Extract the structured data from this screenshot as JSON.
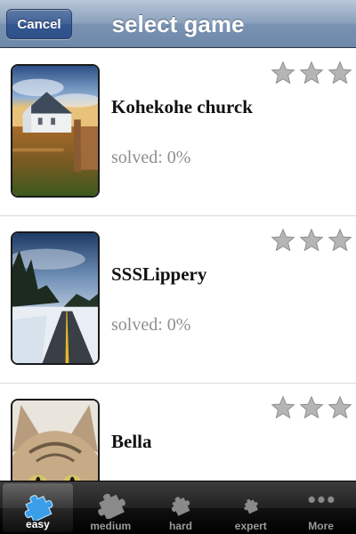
{
  "navbar": {
    "cancel_label": "Cancel",
    "title": "select game"
  },
  "games": [
    {
      "title": "Kohekohe churck",
      "status": "solved: 0%",
      "image": "church-photo",
      "stars": 3
    },
    {
      "title": "SSSLippery",
      "status": "solved: 0%",
      "image": "snowy-road-photo",
      "stars": 3
    },
    {
      "title": "Bella",
      "status": "",
      "image": "cat-photo",
      "stars": 3
    }
  ],
  "tabs": [
    {
      "label": "easy",
      "icon": "puzzle-piece-icon",
      "active": true
    },
    {
      "label": "medium",
      "icon": "puzzle-piece-icon",
      "active": false
    },
    {
      "label": "hard",
      "icon": "puzzle-piece-icon",
      "active": false
    },
    {
      "label": "expert",
      "icon": "puzzle-piece-icon",
      "active": false
    },
    {
      "label": "More",
      "icon": "more-dots-icon",
      "active": false
    }
  ],
  "colors": {
    "navbar": "#7a93b3",
    "cancel_button": "#345690",
    "title_text": "#111111",
    "status_text": "#8e8e8e",
    "star": "#b5b5b5",
    "tab_active_icon": "#3a9ee8",
    "tab_inactive_icon": "#8a8a8a"
  }
}
